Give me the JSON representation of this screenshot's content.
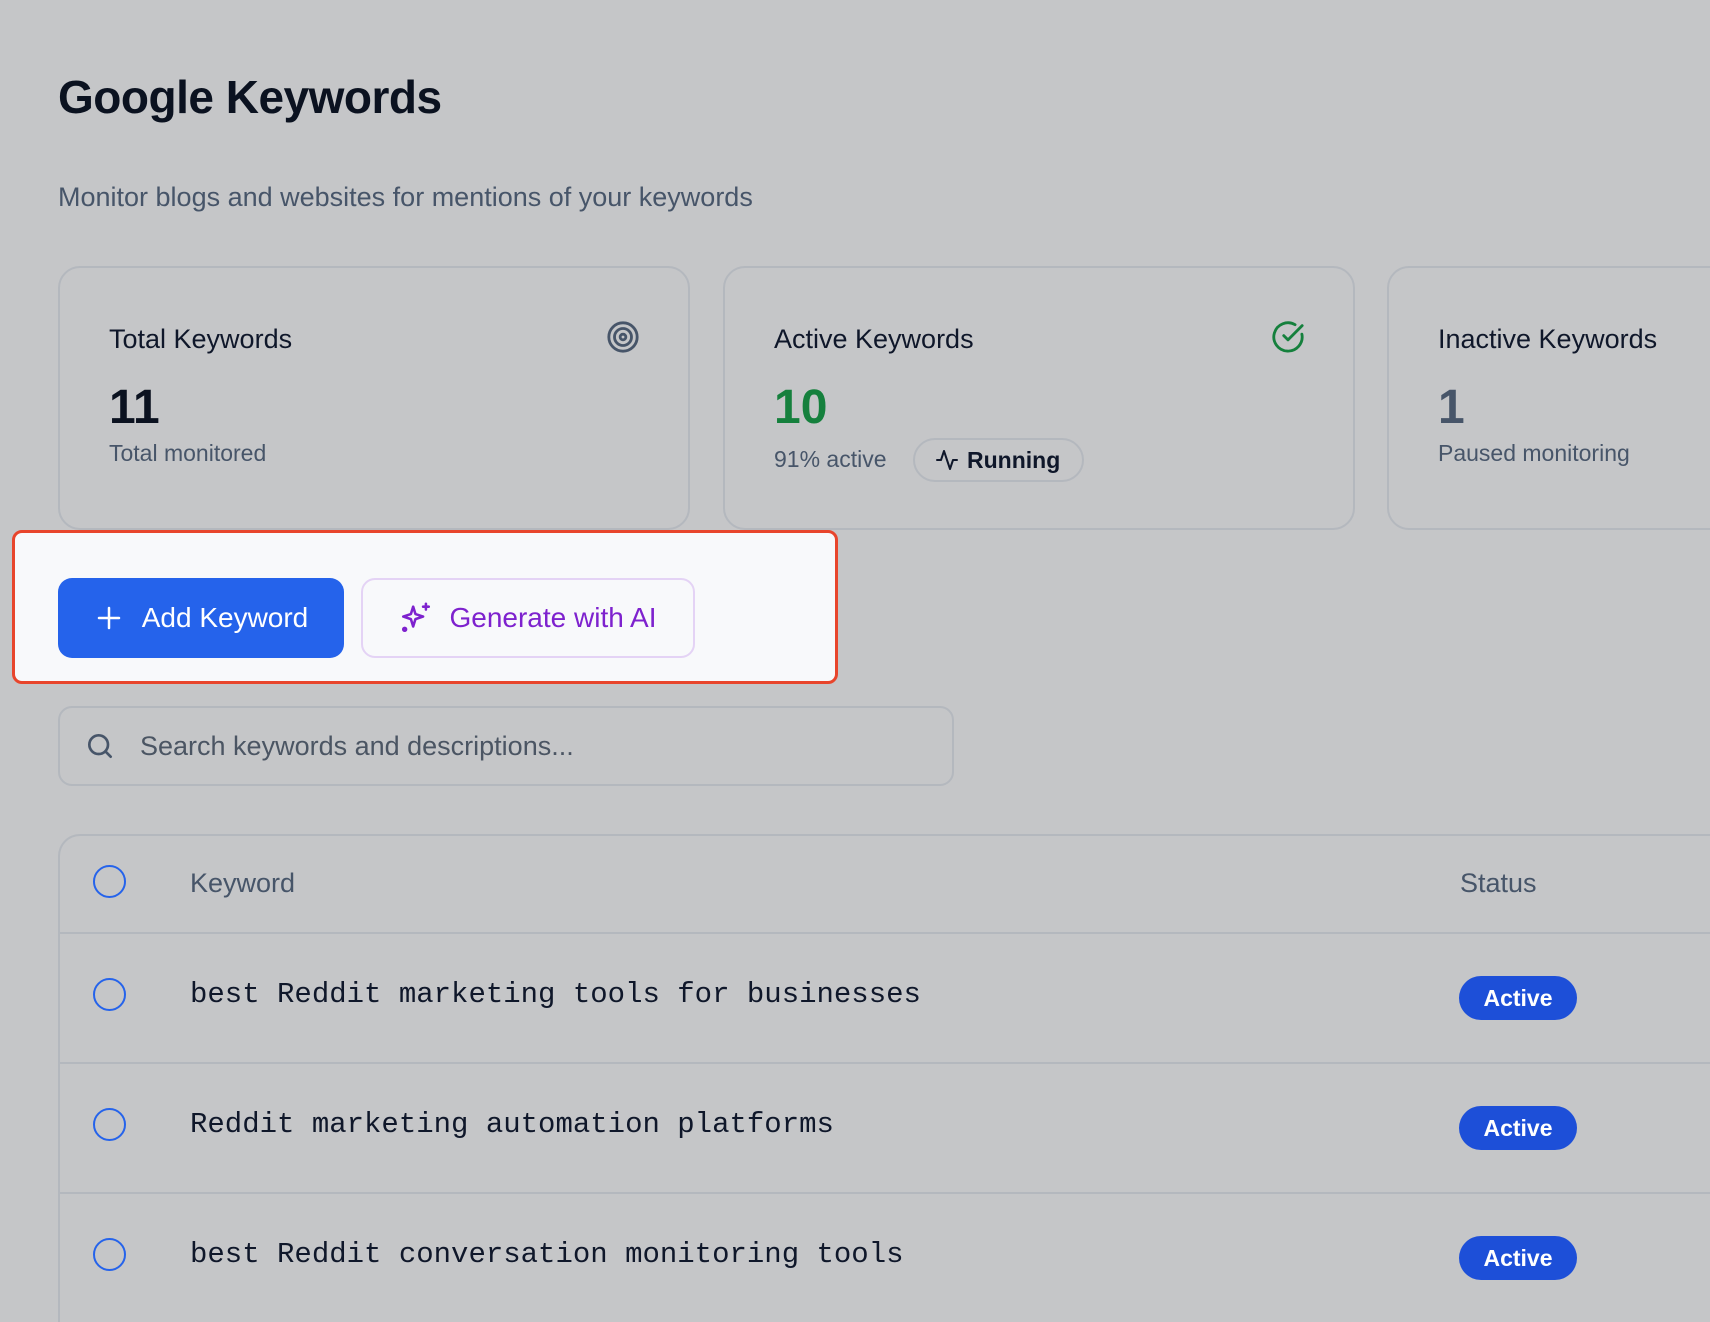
{
  "page": {
    "title": "Google Keywords",
    "subtitle": "Monitor blogs and websites for mentions of your keywords"
  },
  "stats": {
    "total": {
      "label": "Total Keywords",
      "value": "11",
      "caption": "Total monitored",
      "icon": "target-icon"
    },
    "active": {
      "label": "Active Keywords",
      "value": "10",
      "caption": "91% active",
      "badge": "Running",
      "icon": "check-circle-icon",
      "color": "#15803d"
    },
    "inactive": {
      "label": "Inactive Keywords",
      "value": "1",
      "caption": "Paused monitoring"
    }
  },
  "actions": {
    "add_label": "Add Keyword",
    "ai_label": "Generate with AI",
    "accent": "#2563eb",
    "ai_color": "#7e22ce"
  },
  "search": {
    "placeholder": "Search keywords and descriptions...",
    "value": ""
  },
  "table": {
    "columns": {
      "keyword": "Keyword",
      "status": "Status"
    },
    "rows": [
      {
        "keyword": "best Reddit marketing tools for businesses",
        "status": "Active"
      },
      {
        "keyword": "Reddit marketing automation platforms",
        "status": "Active"
      },
      {
        "keyword": "best Reddit conversation monitoring tools",
        "status": "Active"
      }
    ]
  }
}
